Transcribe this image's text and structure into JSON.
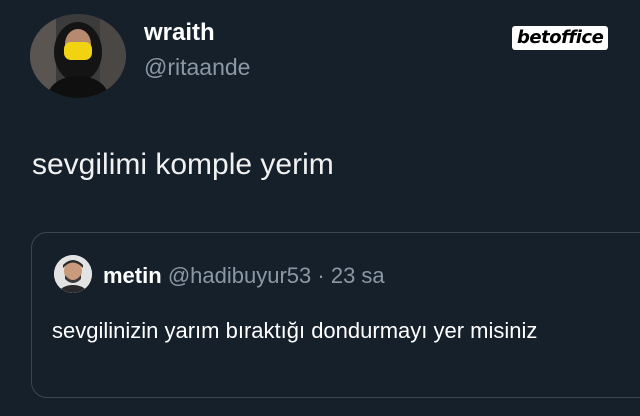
{
  "tweet": {
    "display_name": "wraith",
    "handle": "@ritaande",
    "text": "sevgilimi komple yerim"
  },
  "watermark": "betoffice",
  "quoted": {
    "display_name": "metin",
    "handle": "@hadibuyur53",
    "separator": "·",
    "time": "23 sa",
    "text": "sevgilinizin yarım bıraktığı dondurmayı yer misiniz"
  }
}
